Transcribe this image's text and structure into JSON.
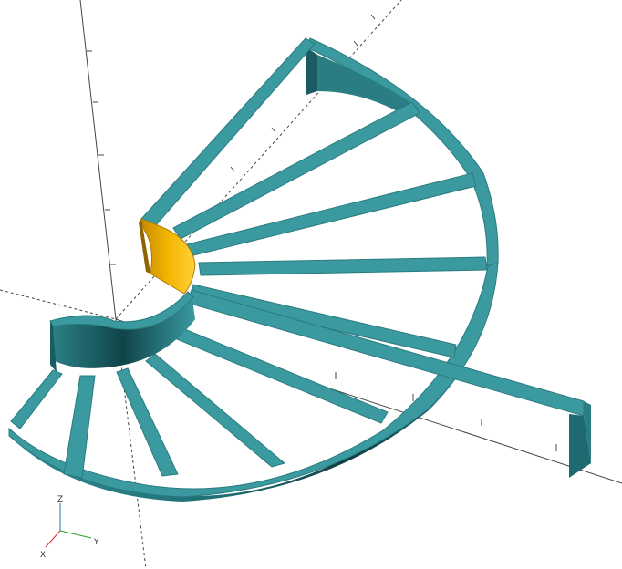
{
  "app": {
    "view": "3D preview"
  },
  "axes_indicator": {
    "x_label": "X",
    "y_label": "Y",
    "z_label": "Z",
    "x_color": "#d62728",
    "y_color": "#2ca02c",
    "z_color": "#1f77b4"
  },
  "model": {
    "body_color": "#3a9aa0",
    "highlight_face_color": "#f0b400"
  }
}
